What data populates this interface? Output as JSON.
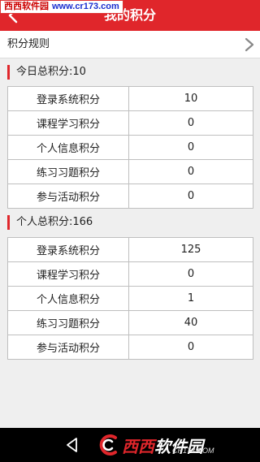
{
  "watermark": {
    "site_name": "西西软件园",
    "url": "www.cr173.com"
  },
  "header": {
    "title": "我的积分"
  },
  "rules": {
    "label": "积分规则"
  },
  "today": {
    "title": "今日总积分:10",
    "rows": [
      {
        "name": "登录系统积分",
        "value": "10"
      },
      {
        "name": "课程学习积分",
        "value": "0"
      },
      {
        "name": "个人信息积分",
        "value": "0"
      },
      {
        "name": "练习习题积分",
        "value": "0"
      },
      {
        "name": "参与活动积分",
        "value": "0"
      }
    ]
  },
  "personal": {
    "title": "个人总积分:166",
    "rows": [
      {
        "name": "登录系统积分",
        "value": "125"
      },
      {
        "name": "课程学习积分",
        "value": "0"
      },
      {
        "name": "个人信息积分",
        "value": "1"
      },
      {
        "name": "练习习题积分",
        "value": "40"
      },
      {
        "name": "参与活动积分",
        "value": "0"
      }
    ]
  },
  "footer_logo": {
    "brand_red": "西西",
    "brand_white": "软件园",
    "url": "CR173.COM"
  },
  "colors": {
    "accent": "#e0262b",
    "background": "#efefef",
    "border": "#bfbfbf"
  }
}
